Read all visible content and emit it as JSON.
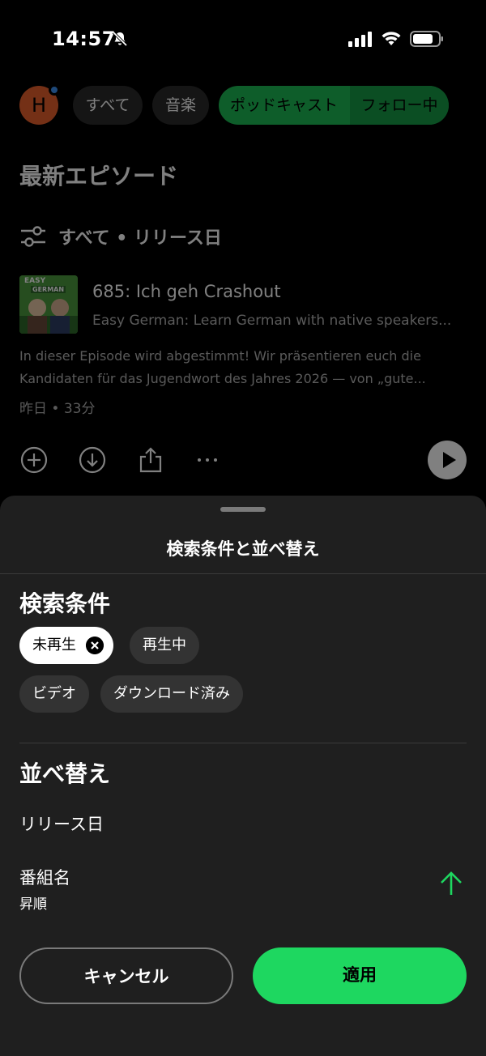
{
  "status_bar": {
    "time": "14:57"
  },
  "background": {
    "avatar_letter": "H",
    "chips": [
      "すべて",
      "音楽",
      "ポッドキャスト",
      "フォロー中"
    ],
    "section_title": "最新エピソード",
    "filter_summary": "すべて • リリース日",
    "episode": {
      "art_text_top": "EASY",
      "art_text_bottom": "GERMAN",
      "title": "685: Ich geh Crashout",
      "show": "Easy German: Learn German with native speakers...",
      "description_line1": "In dieser Episode wird abgestimmt! Wir präsentieren euch die",
      "description_line2": "Kandidaten für das Jugendwort des Jahres 2026 — von „gute...",
      "meta": "昨日 • 33分"
    }
  },
  "sheet": {
    "title": "検索条件と並べ替え",
    "filters_heading": "検索条件",
    "filters": [
      {
        "label": "未再生",
        "selected": true
      },
      {
        "label": "再生中",
        "selected": false
      },
      {
        "label": "ビデオ",
        "selected": false
      },
      {
        "label": "ダウンロード済み",
        "selected": false
      }
    ],
    "sort_heading": "並べ替え",
    "sort_options": [
      {
        "label": "リリース日",
        "sublabel": ""
      },
      {
        "label": "番組名",
        "sublabel": "昇順",
        "active": true
      }
    ],
    "cancel_label": "キャンセル",
    "apply_label": "適用"
  },
  "colors": {
    "accent": "#1ed760",
    "avatar": "#e8612c",
    "notification_dot": "#3d91f4",
    "sheet_bg": "#1f1f1f"
  },
  "icons": [
    "bell-off-icon",
    "signal-icon",
    "wifi-icon",
    "battery-icon",
    "filter-sliders-icon",
    "add-circle-icon",
    "download-icon",
    "share-icon",
    "more-icon",
    "play-icon",
    "close-icon",
    "arrow-up-icon"
  ]
}
